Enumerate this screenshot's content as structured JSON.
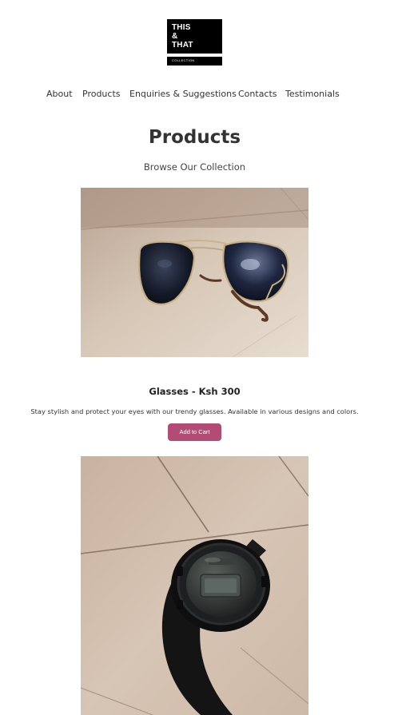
{
  "logo": {
    "line1": "THIS",
    "line2": "&",
    "line3": "THAT",
    "subtitle": "COLLECTION"
  },
  "nav": {
    "items": [
      {
        "label": "About"
      },
      {
        "label": "Products"
      },
      {
        "label": "Enquiries & Suggestions"
      },
      {
        "label": "Contacts"
      },
      {
        "label": "Testimonials"
      }
    ]
  },
  "page": {
    "title": "Products",
    "subtitle": "Browse Our Collection"
  },
  "products": [
    {
      "name": "Glasses - Ksh 300",
      "description": "Stay stylish and protect your eyes with our trendy glasses. Available in various designs and colors.",
      "button_label": "Add to Cart",
      "image_alt": "Sunglasses on a tiled floor"
    },
    {
      "image_alt": "Black digital wristwatch on a tiled floor"
    }
  ],
  "colors": {
    "accent_button": "#b34c74",
    "text": "#333333",
    "logo_bg": "#000000"
  }
}
